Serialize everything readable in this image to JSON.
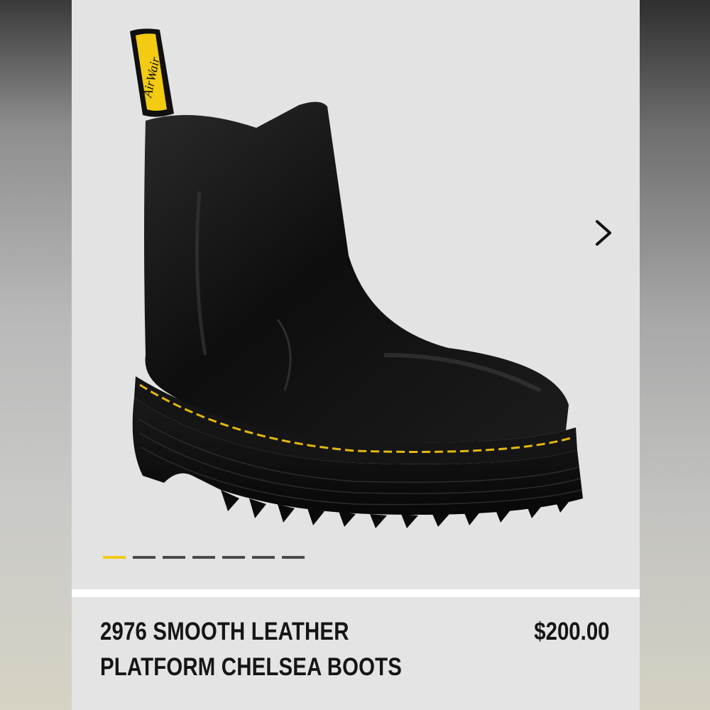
{
  "carousel": {
    "next_icon": "chevron-right-icon",
    "slide_count": 7,
    "active_slide": 1,
    "active_color": "#f2cb12",
    "inactive_color": "#4a4a4a"
  },
  "image": {
    "pull_tab_text": "AirWair"
  },
  "product": {
    "title_line1": "2976 SMOOTH LEATHER",
    "title_line2": "PLATFORM CHELSEA BOOTS",
    "price": "$200.00"
  }
}
